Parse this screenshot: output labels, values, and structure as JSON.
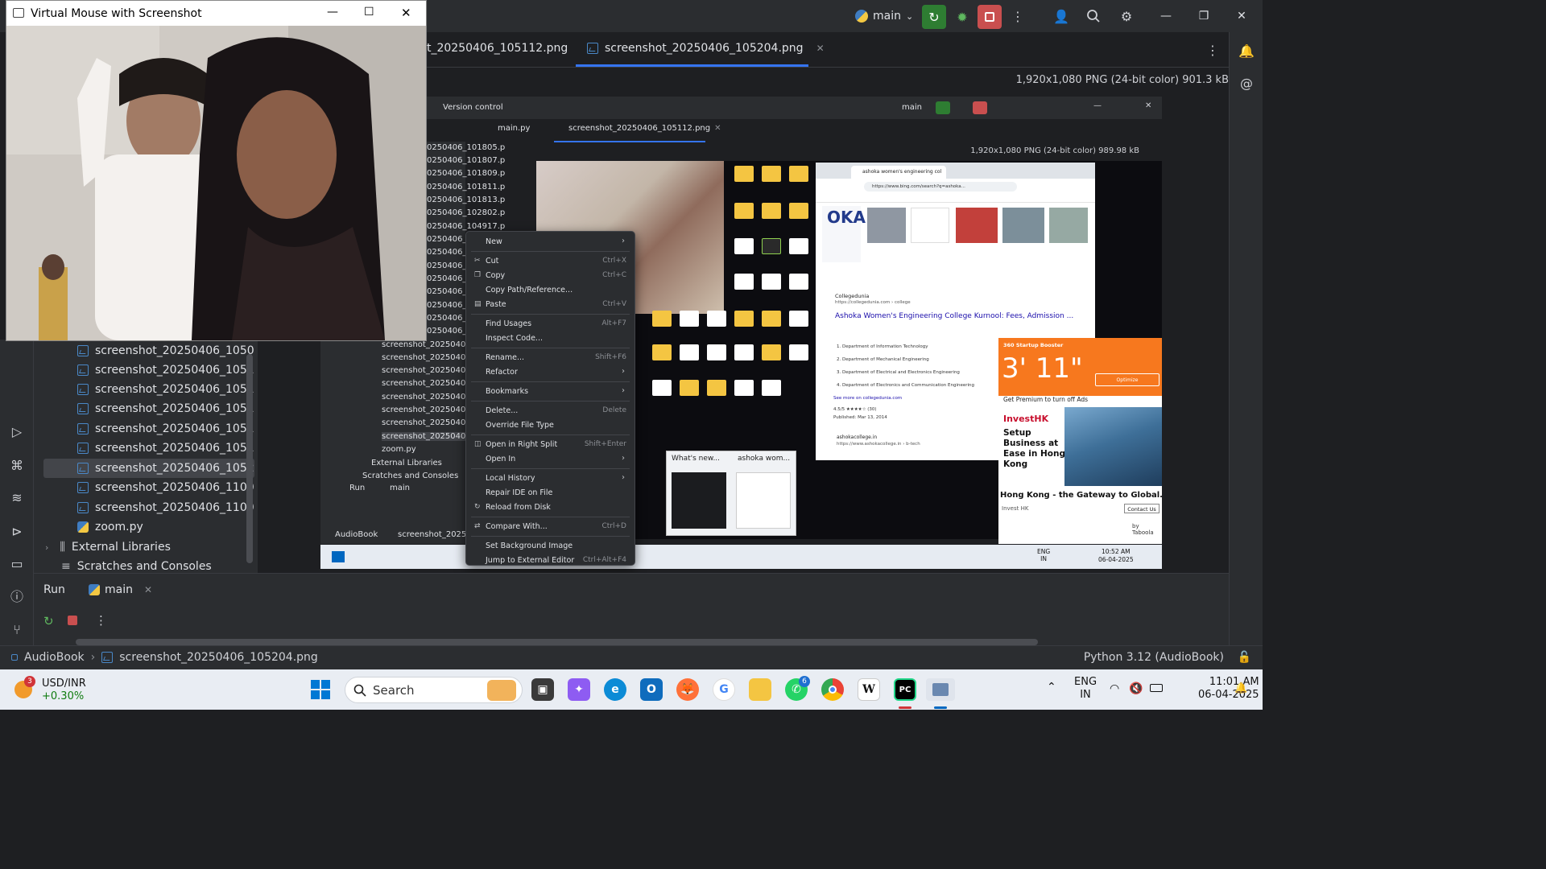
{
  "titlebar": {
    "branch": "main",
    "window_controls": [
      "minimize",
      "restore",
      "close"
    ]
  },
  "editor_tabs": [
    {
      "label": "t_20250406_105112.png",
      "active": false
    },
    {
      "label": "screenshot_20250406_105204.png",
      "active": true
    }
  ],
  "image_info": "1,920x1,080 PNG (24-bit color) 901.3 kB",
  "project_tree": {
    "files": [
      "screenshot_20250406_105059.p",
      "screenshot_20250406_105100.p",
      "screenshot_20250406_105102.p",
      "screenshot_20250406_105104.p",
      "screenshot_20250406_105106.p",
      "screenshot_20250406_105112.p",
      "screenshot_20250406_105204.p",
      "screenshot_20250406_110043.p",
      "screenshot_20250406_110045.p"
    ],
    "selected_index": 6,
    "zoom_file": "zoom.py",
    "external_libraries": "External Libraries",
    "scratches": "Scratches and Consoles"
  },
  "camera_window": {
    "title": "Virtual Mouse with Screenshot"
  },
  "inner_screenshot": {
    "version_control": "Version control",
    "branch": "main",
    "tabs": [
      "main.py",
      "screenshot_20250406_105112.png"
    ],
    "image_info": "1,920x1,080 PNG (24-bit color) 989.98 kB",
    "tree_rows": [
      "0250406_101805.p",
      "0250406_101807.p",
      "0250406_101809.p",
      "0250406_101811.p",
      "0250406_101813.p",
      "0250406_102802.p",
      "0250406_104917.p",
      "0250406_1(",
      "0250406_1(",
      "0250406_1(",
      "0250406_1(",
      "0250406_1(",
      "0250406_1(",
      "0250406_1(",
      "0250406_1("
    ],
    "tree_rows_lower": [
      "screenshot_20250406_1(",
      "screenshot_20250406_1(",
      "screenshot_20250406_1(",
      "screenshot_20250406_1(",
      "screenshot_20250406_1(",
      "screenshot_20250406_1(",
      "screenshot_20250406_1(",
      "screenshot_20250406_1("
    ],
    "zoom_file": "zoom.py",
    "external_libraries": "External Libraries",
    "scratches": "Scratches and Consoles",
    "run_label": "Run",
    "run_config": "main",
    "breadcrumb_root": "AudioBook",
    "breadcrumb_file": "screenshot_2025040",
    "browser": {
      "url": "https://www.bing.com/search?q=ashoka...",
      "tab_title": "ashoka women's engineering col",
      "result_source": "Collegedunia",
      "result_url": "https://collegedunia.com › college",
      "result_title": "Ashoka Women's Engineering College Kurnool: Fees, Admission ...",
      "departments": [
        "1. Department of Information Technology",
        "2. Department of Mechanical Engineering",
        "3. Department of Electrical and Electronics Engineering",
        "4. Department of Electronics and Communication Engineering"
      ],
      "more_link": "See more on collegedunia.com",
      "rating": "4.5/5 ★★★★☆ (30)",
      "published": "Published: Mar 13, 2014",
      "second_source": "ashokacollege.in",
      "second_url": "https://www.ashokacollege.in › b-tech"
    },
    "ad": {
      "header": "360 Startup Booster",
      "time": "3' 11\"",
      "optimize": "Optimize",
      "premium": "Get Premium to turn off Ads",
      "brand": "InvestHK",
      "headline": "Setup Business at Ease in Hong Kong",
      "footer_title": "Hong Kong - the Gateway to Global...",
      "footer_source": "Invest HK",
      "contact": "Contact Us",
      "by": "by Taboola"
    },
    "previews": [
      "What's new...",
      "ashoka wom..."
    ],
    "taskbar_lang": [
      "ENG",
      "IN"
    ],
    "taskbar_time": [
      "10:52 AM",
      "06-04-2025"
    ]
  },
  "context_menu": [
    {
      "label": "New",
      "shortcut": "",
      "submenu": true,
      "icon": "",
      "sep_after": true
    },
    {
      "label": "Cut",
      "shortcut": "Ctrl+X",
      "submenu": false,
      "icon": "✂"
    },
    {
      "label": "Copy",
      "shortcut": "Ctrl+C",
      "submenu": false,
      "icon": "❐"
    },
    {
      "label": "Copy Path/Reference...",
      "shortcut": "",
      "submenu": false,
      "icon": ""
    },
    {
      "label": "Paste",
      "shortcut": "Ctrl+V",
      "submenu": false,
      "icon": "▤",
      "sep_after": true
    },
    {
      "label": "Find Usages",
      "shortcut": "Alt+F7",
      "submenu": false,
      "icon": ""
    },
    {
      "label": "Inspect Code...",
      "shortcut": "",
      "submenu": false,
      "icon": "",
      "sep_after": true
    },
    {
      "label": "Rename...",
      "shortcut": "Shift+F6",
      "submenu": false,
      "icon": ""
    },
    {
      "label": "Refactor",
      "shortcut": "",
      "submenu": true,
      "icon": "",
      "sep_after": true
    },
    {
      "label": "Bookmarks",
      "shortcut": "",
      "submenu": true,
      "icon": "",
      "sep_after": true
    },
    {
      "label": "Delete...",
      "shortcut": "Delete",
      "submenu": false,
      "icon": ""
    },
    {
      "label": "Override File Type",
      "shortcut": "",
      "submenu": false,
      "icon": "",
      "sep_after": true
    },
    {
      "label": "Open in Right Split",
      "shortcut": "Shift+Enter",
      "submenu": false,
      "icon": "◫"
    },
    {
      "label": "Open In",
      "shortcut": "",
      "submenu": true,
      "icon": "",
      "sep_after": true
    },
    {
      "label": "Local History",
      "shortcut": "",
      "submenu": true,
      "icon": ""
    },
    {
      "label": "Repair IDE on File",
      "shortcut": "",
      "submenu": false,
      "icon": ""
    },
    {
      "label": "Reload from Disk",
      "shortcut": "",
      "submenu": false,
      "icon": "↻",
      "sep_after": true
    },
    {
      "label": "Compare With...",
      "shortcut": "Ctrl+D",
      "submenu": false,
      "icon": "⇄",
      "sep_after": true
    },
    {
      "label": "Set Background Image",
      "shortcut": "",
      "submenu": false,
      "icon": ""
    },
    {
      "label": "Jump to External Editor",
      "shortcut": "Ctrl+Alt+F4",
      "submenu": false,
      "icon": ""
    }
  ],
  "run_panel": {
    "label": "Run",
    "config": "main"
  },
  "statusbar": {
    "project": "AudioBook",
    "file": "screenshot_20250406_105204.png",
    "interpreter": "Python 3.12 (AudioBook)"
  },
  "taskbar": {
    "weather_label": "USD/INR",
    "weather_value": "+0.30%",
    "weather_badge": "3",
    "search_placeholder": "Search",
    "whatsapp_badge": "6",
    "lang": "ENG",
    "region": "IN",
    "time": "11:01 AM",
    "date": "06-04-2025"
  }
}
